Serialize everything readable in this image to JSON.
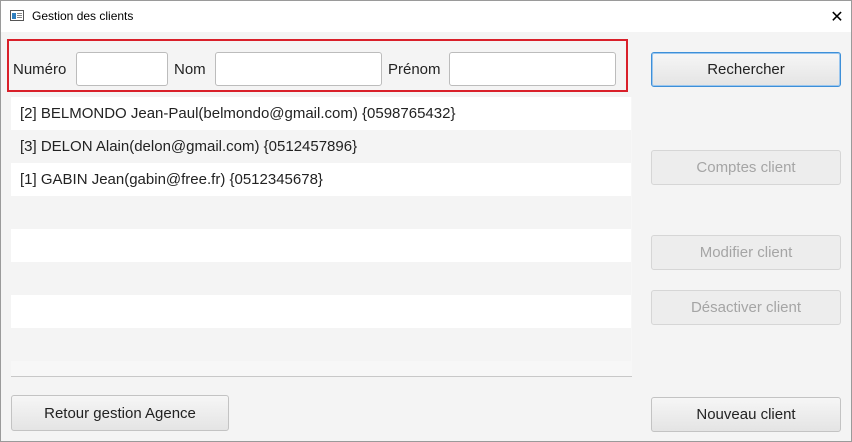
{
  "window": {
    "title": "Gestion des clients",
    "close_glyph": "✕",
    "icon": "app-window-icon"
  },
  "filters": {
    "numero_label": "Numéro",
    "numero_value": "",
    "nom_label": "Nom",
    "nom_value": "",
    "prenom_label": "Prénom",
    "prenom_value": ""
  },
  "clients": [
    {
      "text": "[2]  BELMONDO Jean-Paul(belmondo@gmail.com)  {0598765432}"
    },
    {
      "text": "[3]  DELON Alain(delon@gmail.com)  {0512457896}"
    },
    {
      "text": "[1]  GABIN Jean(gabin@free.fr)  {0512345678}"
    }
  ],
  "buttons": {
    "rechercher": "Rechercher",
    "comptes": "Comptes client",
    "modifier": "Modifier client",
    "desactiver": "Désactiver client",
    "nouveau": "Nouveau client",
    "retour": "Retour gestion Agence"
  },
  "colors": {
    "highlight_border": "#d9202a",
    "focus_border": "#3d8fd8"
  }
}
